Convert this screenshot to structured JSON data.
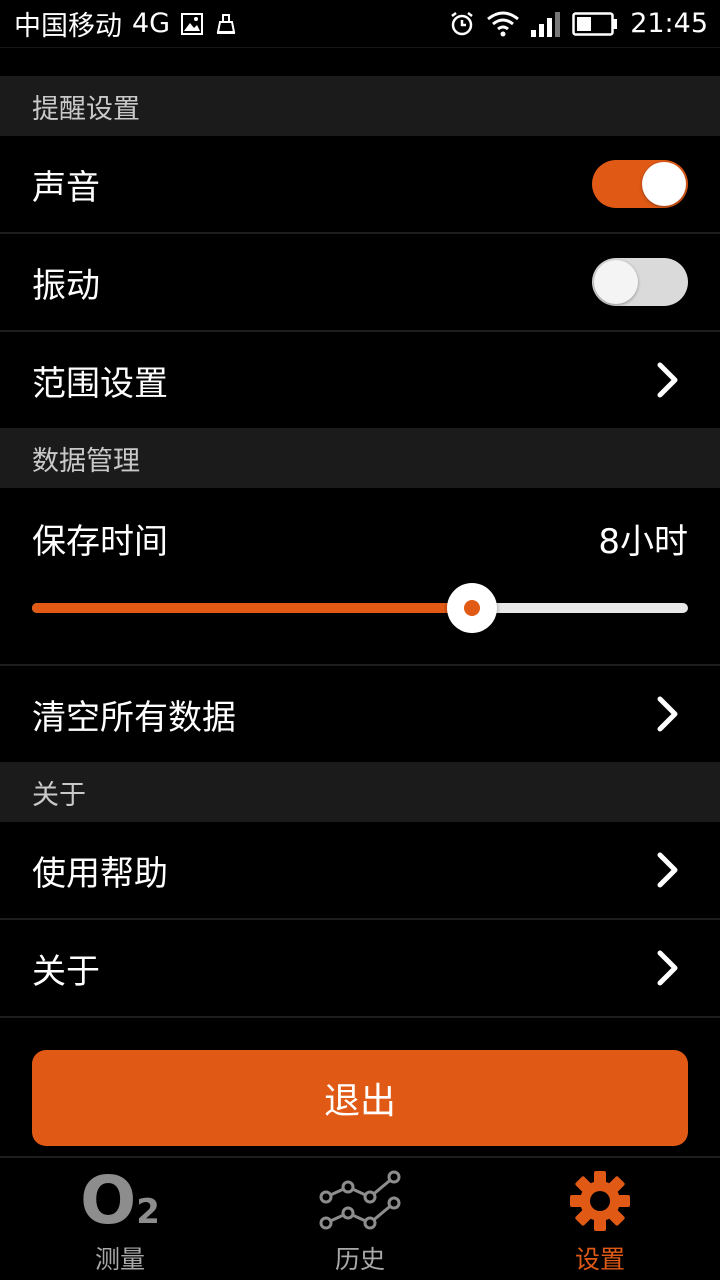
{
  "status_bar": {
    "carrier": "中国移动",
    "network": "4G",
    "time": "21:45",
    "icons": [
      "image-icon",
      "usb-icon",
      "alarm-icon",
      "wifi-icon",
      "signal-icon",
      "battery-icon"
    ],
    "battery_level": 0.4
  },
  "sections": {
    "reminder": {
      "title": "提醒设置"
    },
    "data": {
      "title": "数据管理"
    },
    "about": {
      "title": "关于"
    }
  },
  "rows": {
    "sound": {
      "label": "声音",
      "enabled": true
    },
    "vibration": {
      "label": "振动",
      "enabled": false
    },
    "range": {
      "label": "范围设置"
    },
    "retention": {
      "label": "保存时间",
      "value": "8小时",
      "slider_fraction": 0.67
    },
    "clear": {
      "label": "清空所有数据"
    },
    "help": {
      "label": "使用帮助"
    },
    "about": {
      "label": "关于"
    }
  },
  "logout": {
    "label": "退出"
  },
  "bottom_nav": {
    "items": [
      {
        "label": "测量",
        "icon": "o2-icon",
        "active": false
      },
      {
        "label": "历史",
        "icon": "history-graph-icon",
        "active": false
      },
      {
        "label": "设置",
        "icon": "gear-icon",
        "active": true
      }
    ]
  },
  "colors": {
    "accent": "#e05a16",
    "background": "#000000",
    "section_header_bg": "#1b1b1b",
    "inactive_nav": "#a9a9a9"
  }
}
